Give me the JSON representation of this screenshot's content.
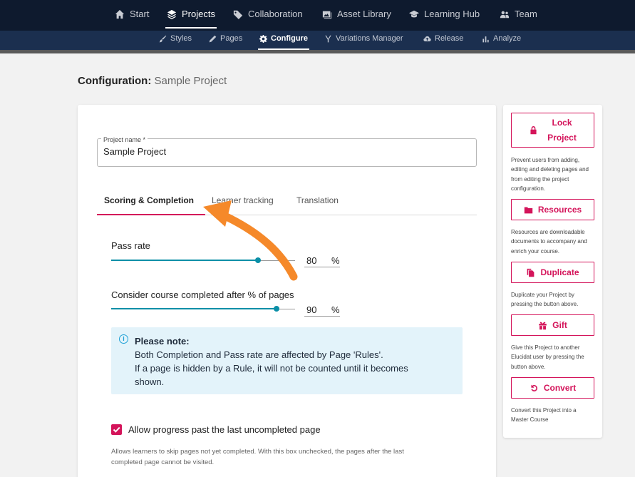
{
  "topnav": {
    "items": [
      {
        "label": "Start",
        "icon": "home-icon"
      },
      {
        "label": "Projects",
        "icon": "layers-icon",
        "active": true
      },
      {
        "label": "Collaboration",
        "icon": "tag-icon"
      },
      {
        "label": "Asset Library",
        "icon": "images-icon"
      },
      {
        "label": "Learning Hub",
        "icon": "graduation-cap-icon"
      },
      {
        "label": "Team",
        "icon": "users-icon"
      }
    ]
  },
  "subnav": {
    "items": [
      {
        "label": "Styles",
        "icon": "brush-icon"
      },
      {
        "label": "Pages",
        "icon": "pencil-icon"
      },
      {
        "label": "Configure",
        "icon": "gear-icon",
        "active": true
      },
      {
        "label": "Variations Manager",
        "icon": "branch-icon"
      },
      {
        "label": "Release",
        "icon": "cloud-upload-icon"
      },
      {
        "label": "Analyze",
        "icon": "bar-chart-icon"
      }
    ]
  },
  "page": {
    "title_prefix": "Configuration:",
    "project": "Sample Project"
  },
  "project_name": {
    "label": "Project name *",
    "value": "Sample Project"
  },
  "tabs": [
    {
      "label": "Scoring & Completion",
      "active": true
    },
    {
      "label": "Learner tracking"
    },
    {
      "label": "Translation"
    }
  ],
  "pass_rate": {
    "label": "Pass rate",
    "value": "80",
    "unit": "%",
    "slider_fraction": 0.8
  },
  "completion": {
    "label": "Consider course completed after % of pages",
    "value": "90",
    "unit": "%",
    "slider_fraction": 0.9
  },
  "note": {
    "title": "Please note:",
    "lines": [
      "Both Completion and Pass rate are affected by Page 'Rules'.",
      "If a page is hidden by a Rule, it will not be counted until it becomes",
      "shown."
    ]
  },
  "allow_progress": {
    "label": "Allow progress past the last uncompleted page",
    "checked": true,
    "help": [
      "Allows learners to skip pages not yet completed. With this box unchecked, the pages after the last",
      "completed page cannot be visited."
    ]
  },
  "side": {
    "lock": {
      "label": [
        "Lock",
        "Project"
      ],
      "desc": [
        "Prevent users from adding,",
        "editing and deleting pages and",
        "from editing the project",
        "configuration."
      ]
    },
    "resources": {
      "label": "Resources",
      "desc": [
        "Resources are downloadable",
        "documents to accompany and",
        "enrich your course."
      ]
    },
    "duplicate": {
      "label": "Duplicate",
      "desc": [
        "Duplicate your Project by",
        "pressing the button above."
      ]
    },
    "gift": {
      "label": "Gift",
      "desc": [
        "Give this Project to another",
        "Elucidat user by pressing the",
        "button above."
      ]
    },
    "convert": {
      "label": "Convert",
      "desc": [
        "Convert this Project into a",
        "Master Course"
      ]
    }
  },
  "colors": {
    "accent": "#d4145a",
    "slider": "#0a8fa7",
    "nav_top": "#0e1a2e",
    "nav_sub": "#1b2f4f",
    "note_bg": "#e3f3fa",
    "annotation_arrow": "#f5892a"
  }
}
